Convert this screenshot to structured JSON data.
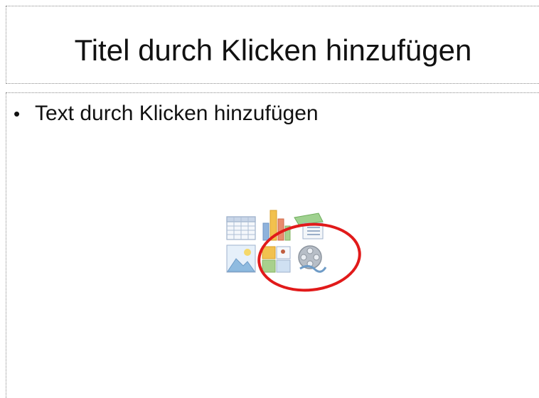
{
  "slide": {
    "title_placeholder": "Titel durch Klicken hinzufügen",
    "content_placeholder": "Text durch Klicken hinzufügen",
    "bullet": "•"
  },
  "content_icons": [
    {
      "name": "table-icon"
    },
    {
      "name": "chart-icon"
    },
    {
      "name": "smartart-icon"
    },
    {
      "name": "picture-icon"
    },
    {
      "name": "clip-art-icon"
    },
    {
      "name": "media-clip-icon"
    }
  ],
  "colors": {
    "highlight": "#e11a1a",
    "placeholder_border": "#8a8a8a"
  }
}
